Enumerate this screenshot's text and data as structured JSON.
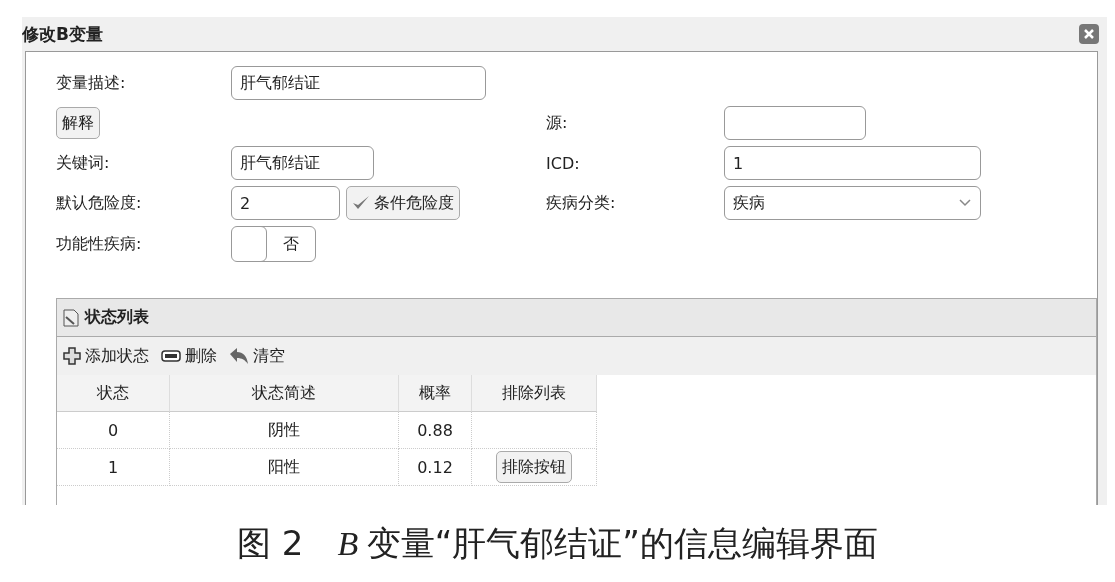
{
  "window": {
    "title": "修改B变量"
  },
  "form": {
    "description": {
      "label": "变量描述:",
      "value": "肝气郁结证"
    },
    "explain_button": "解释",
    "source": {
      "label": "源:"
    },
    "keyword": {
      "label": "关键词:",
      "value": "肝气郁结证"
    },
    "icd": {
      "label": "ICD:",
      "value": "1"
    },
    "default_risk": {
      "label": "默认危险度:",
      "value": "2"
    },
    "conditional_risk_button": "条件危险度",
    "disease_category": {
      "label": "疾病分类:",
      "value": "疾病"
    },
    "functional_disease": {
      "label": "功能性疾病:",
      "on": false,
      "text": "否"
    }
  },
  "state_panel": {
    "title": "状态列表",
    "toolbar": [
      {
        "kind": "add",
        "label": "添加状态"
      },
      {
        "kind": "delete",
        "label": "删除"
      },
      {
        "kind": "clear",
        "label": "清空"
      }
    ],
    "columns": [
      "状态",
      "状态简述",
      "概率",
      "排除列表"
    ],
    "rows": [
      {
        "state": "0",
        "summary": "阴性",
        "probability": "0.88"
      },
      {
        "state": "1",
        "summary": "阳性",
        "probability": "0.12",
        "exclude_button": "排除按钮"
      }
    ]
  },
  "caption": "图 2　*B* 变量“肝气郁结证”的信息编辑界面"
}
